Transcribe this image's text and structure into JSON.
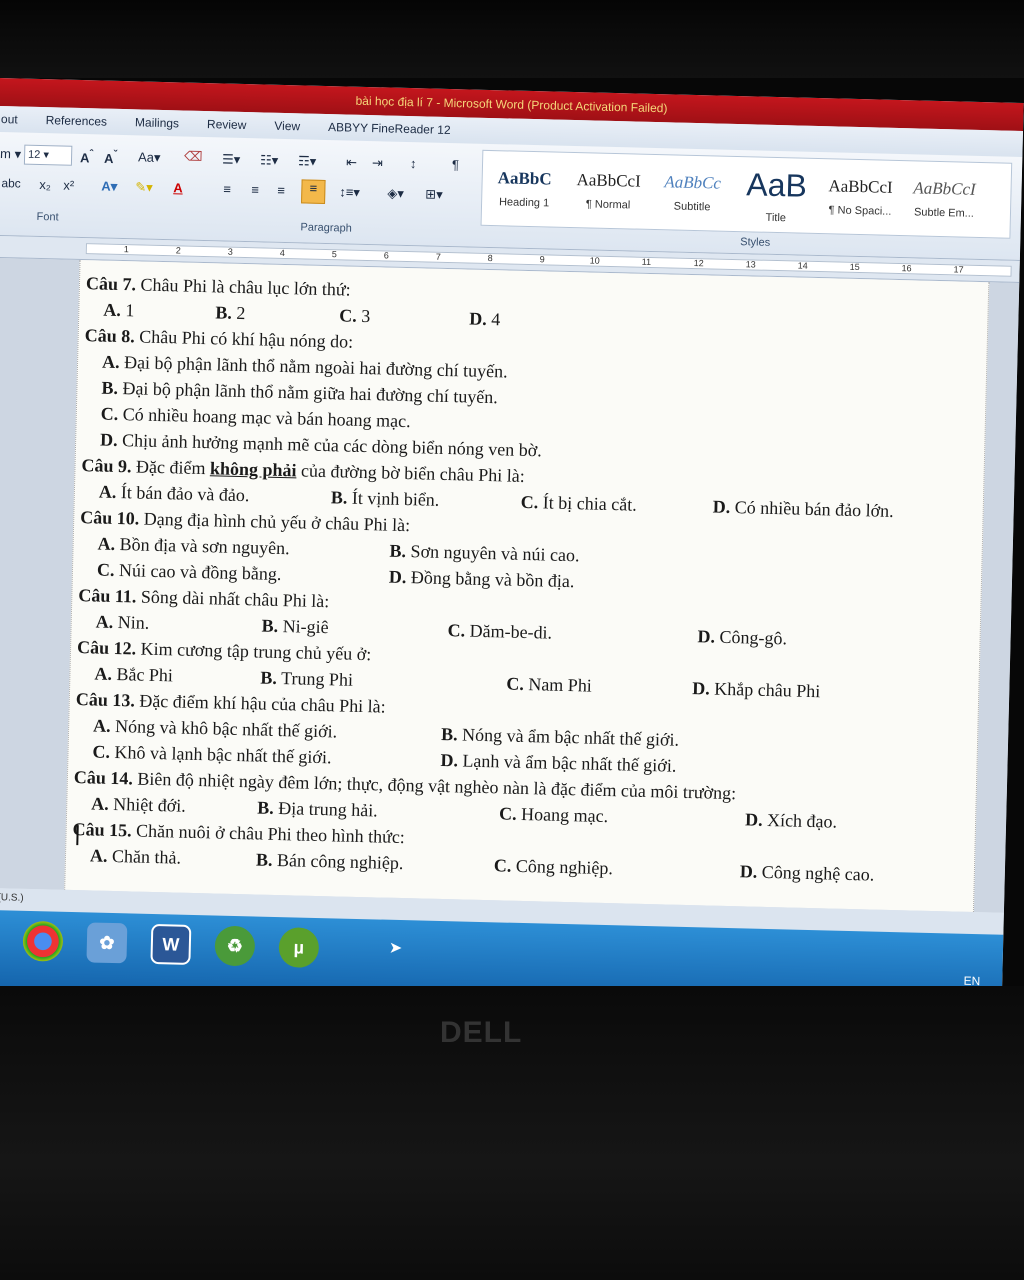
{
  "window": {
    "title": "bài học địa lí 7 - Microsoft Word (Product Activation Failed)"
  },
  "menu": [
    "out",
    "References",
    "Mailings",
    "Review",
    "View",
    "ABBYY FineReader 12"
  ],
  "ribbon": {
    "font_size": "12",
    "font_group": "Font",
    "paragraph_group": "Paragraph",
    "styles_group": "Styles",
    "styles": [
      {
        "sample": "AaBbC",
        "name": "Heading 1"
      },
      {
        "sample": "AaBbCcI",
        "name": "¶ Normal"
      },
      {
        "sample": "AaBbCc",
        "name": "Subtitle"
      },
      {
        "sample": "AaB",
        "name": "Title"
      },
      {
        "sample": "AaBbCcI",
        "name": "¶ No Spaci..."
      },
      {
        "sample": "AaBbCcI",
        "name": "Subtle Em..."
      }
    ]
  },
  "ruler": [
    "1",
    "2",
    "3",
    "4",
    "5",
    "6",
    "7",
    "8",
    "9",
    "10",
    "11",
    "12",
    "13",
    "14",
    "15",
    "16",
    "17"
  ],
  "doc": {
    "q7": {
      "label": "Câu 7.",
      "text": " Châu Phi là châu lục lớn thứ:",
      "a": [
        "A.",
        " 1"
      ],
      "b": [
        "B.",
        " 2"
      ],
      "c": [
        "C.",
        " 3"
      ],
      "d": [
        "D.",
        " 4"
      ]
    },
    "q8": {
      "label": "Câu 8.",
      "text": " Châu Phi có khí hậu nóng do:",
      "opts": [
        [
          "A.",
          " Đại bộ phận lãnh thổ nằm ngoài hai đường chí tuyến."
        ],
        [
          "B.",
          " Đại bộ phận lãnh thổ nằm giữa hai đường chí tuyến."
        ],
        [
          "C.",
          " Có nhiều hoang mạc và bán hoang mạc."
        ],
        [
          "D.",
          " Chịu ảnh hưởng mạnh mẽ của các dòng biển nóng ven bờ."
        ]
      ]
    },
    "q9": {
      "label": "Câu 9.",
      "pre": " Đặc điểm ",
      "emph": "không phải",
      "post": " của đường bờ biển châu Phi là:",
      "a": [
        "A.",
        " Ít bán đảo và đảo."
      ],
      "b": [
        "B.",
        " Ít vịnh biển."
      ],
      "c": [
        "C.",
        " Ít bị chia cắt."
      ],
      "d": [
        "D.",
        " Có nhiều bán đảo lớn."
      ]
    },
    "q10": {
      "label": "Câu 10.",
      "text": " Dạng địa hình chủ yếu ở châu Phi là:",
      "a": [
        "A.",
        " Bồn địa và sơn nguyên."
      ],
      "b": [
        "B.",
        " Sơn nguyên và núi cao."
      ],
      "c": [
        "C.",
        " Núi cao và đồng bằng."
      ],
      "d": [
        "D.",
        " Đồng bằng và bồn địa."
      ]
    },
    "q11": {
      "label": "Câu 11.",
      "text": " Sông dài nhất châu Phi là:",
      "a": [
        "A.",
        " Nin."
      ],
      "b": [
        "B.",
        " Ni-giê"
      ],
      "c": [
        "C.",
        " Dăm-be-di."
      ],
      "d": [
        "D.",
        " Công-gô."
      ]
    },
    "q12": {
      "label": "Câu 12.",
      "text": " Kim cương tập trung chủ yếu ở:",
      "a": [
        "A.",
        " Bắc Phi"
      ],
      "b": [
        "B.",
        " Trung Phi"
      ],
      "c": [
        "C.",
        " Nam Phi"
      ],
      "d": [
        "D.",
        " Khắp châu Phi"
      ]
    },
    "q13": {
      "label": "Câu 13.",
      "text": " Đặc điểm khí hậu của châu Phi là:",
      "a": [
        "A.",
        " Nóng và khô bậc nhất thế giới."
      ],
      "b": [
        "B.",
        " Nóng và ẩm bậc nhất thế giới."
      ],
      "c": [
        "C.",
        " Khô và lạnh bậc nhất thế giới."
      ],
      "d": [
        "D.",
        " Lạnh và ẩm bậc nhất thế giới."
      ]
    },
    "q14": {
      "label": "Câu 14.",
      "text": " Biên độ nhiệt ngày đêm lớn; thực, động vật nghèo nàn là đặc điểm của môi trường:",
      "a": [
        "A.",
        " Nhiệt đới."
      ],
      "b": [
        "B.",
        " Địa trung hải."
      ],
      "c": [
        "C.",
        " Hoang mạc."
      ],
      "d": [
        "D.",
        " Xích đạo."
      ]
    },
    "q15": {
      "label": "Câu 15.",
      "text": " Chăn nuôi ở châu Phi theo hình thức:",
      "a": [
        "A.",
        " Chăn thả."
      ],
      "b": [
        "B.",
        " Bán công nghiệp."
      ],
      "c": [
        "C.",
        " Công nghiệp."
      ],
      "d": [
        "D.",
        " Công nghệ cao."
      ]
    }
  },
  "status": {
    "language": "ish (U.S.)"
  },
  "taskbar": {
    "lang": "EN"
  },
  "brand": "DELL"
}
